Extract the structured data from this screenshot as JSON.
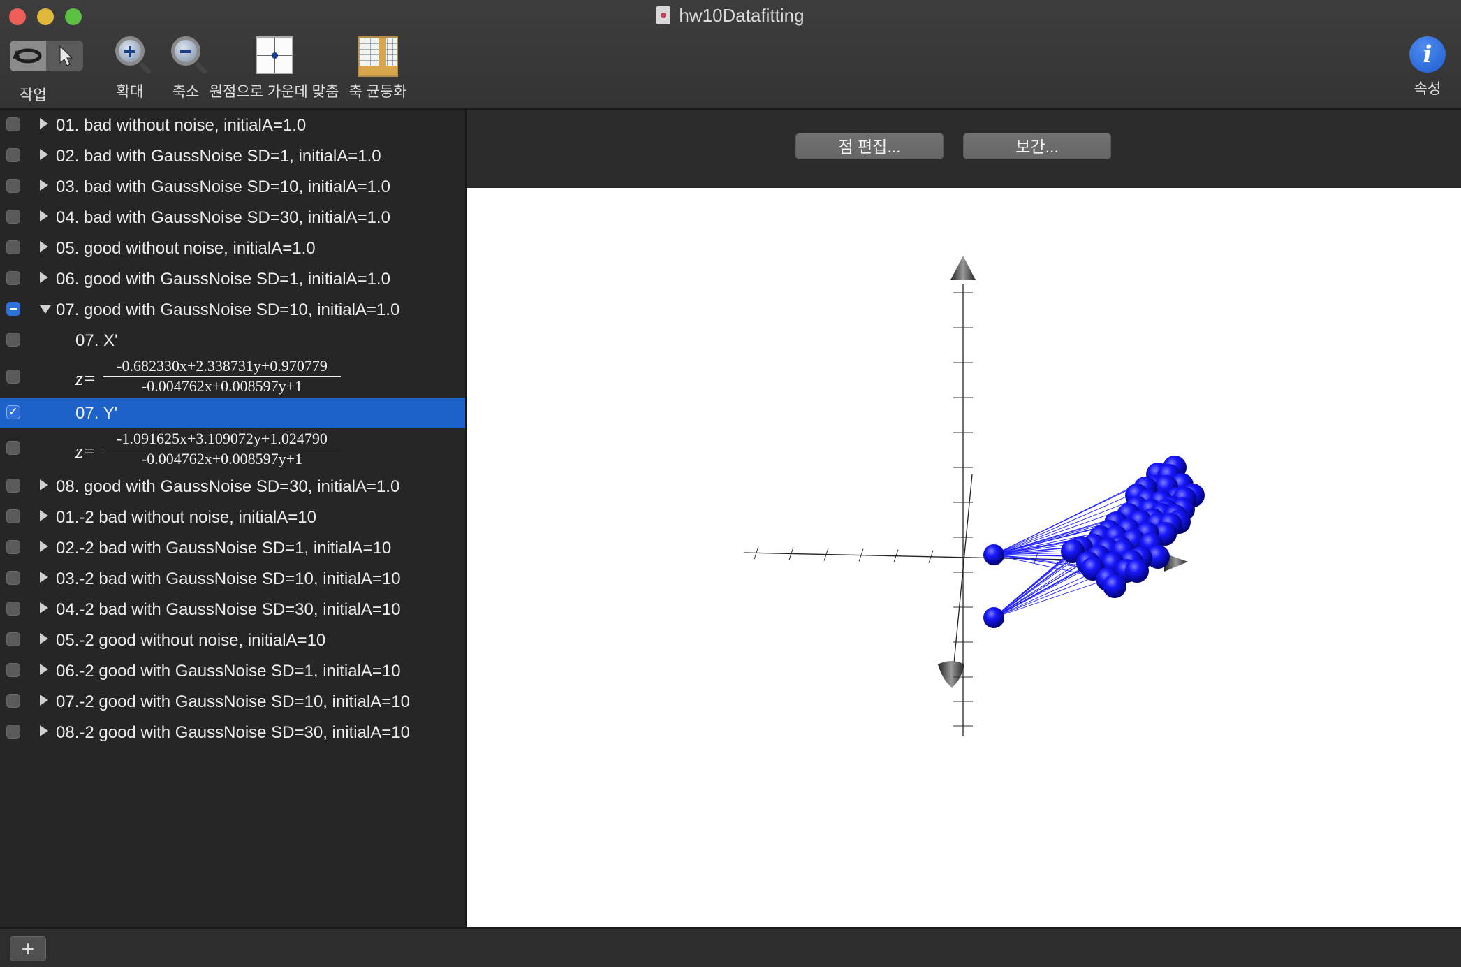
{
  "window": {
    "title": "hw10Datafitting"
  },
  "toolbar": {
    "action_label": "작업",
    "zoom_in_label": "확대",
    "zoom_out_label": "축소",
    "center_origin_label": "원점으로 가운데 맞춤",
    "equalize_axes_label": "축 균등화",
    "properties_label": "속성"
  },
  "main": {
    "edit_points_label": "점 편집...",
    "interpolate_label": "보간..."
  },
  "sidebar": {
    "items": [
      {
        "label": "01. bad without noise, initialA=1.0"
      },
      {
        "label": "02. bad with GaussNoise SD=1, initialA=1.0"
      },
      {
        "label": "03. bad with GaussNoise SD=10, initialA=1.0"
      },
      {
        "label": "04. bad with GaussNoise SD=30, initialA=1.0"
      },
      {
        "label": "05. good without noise, initialA=1.0"
      },
      {
        "label": "06. good with GaussNoise SD=1, initialA=1.0"
      },
      {
        "label": "07. good with GaussNoise SD=10, initialA=1.0"
      },
      {
        "label": "08. good with GaussNoise SD=30, initialA=1.0"
      },
      {
        "label": "01.-2 bad without noise, initialA=10"
      },
      {
        "label": "02.-2 bad with GaussNoise SD=1, initialA=10"
      },
      {
        "label": "03.-2 bad with GaussNoise SD=10, initialA=10"
      },
      {
        "label": "04.-2 bad with GaussNoise SD=30, initialA=10"
      },
      {
        "label": "05.-2 good without noise, initialA=10"
      },
      {
        "label": "06.-2 good with GaussNoise SD=1, initialA=10"
      },
      {
        "label": "07.-2 good with GaussNoise SD=10, initialA=10"
      },
      {
        "label": "08.-2 good with GaussNoise SD=30, initialA=10"
      }
    ],
    "children": {
      "x_label": "07. X'",
      "x_formula": {
        "lhs": "z=",
        "numerator": "-0.682330x+2.338731y+0.970779",
        "denominator": "-0.004762x+0.008597y+1"
      },
      "y_label": "07. Y'",
      "y_formula": {
        "lhs": "z=",
        "numerator": "-1.091625x+3.109072y+1.024790",
        "denominator": "-0.004762x+0.008597y+1"
      }
    }
  },
  "plot": {
    "point_color": "#1010ff",
    "line_color": "#2020ff"
  },
  "bottom": {
    "add_label": "+"
  }
}
